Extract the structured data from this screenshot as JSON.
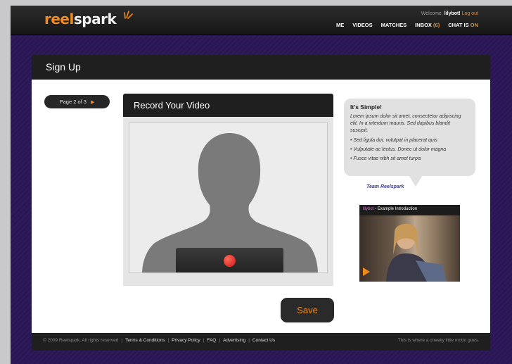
{
  "brand": {
    "logo_text_a": "reel",
    "logo_text_b": "spark"
  },
  "header": {
    "welcome_prefix": "Welcome,",
    "username": "lilybot!",
    "logout": "Log out",
    "nav": [
      {
        "label": "ME"
      },
      {
        "label": "VIDEOS"
      },
      {
        "label": "MATCHES"
      },
      {
        "label": "INBOX",
        "count": "(6)"
      },
      {
        "label": "CHAT IS",
        "status": "ON"
      }
    ]
  },
  "page": {
    "title": "Sign Up",
    "step": "Page 2 of 3"
  },
  "recorder": {
    "title": "Record Your Video",
    "save_label": "Save"
  },
  "tips": {
    "title": "It's Simple!",
    "intro": "Lorem ipsum dolor sit amet, consectetur adipiscing elit. In a interdum mauris. Sed dapibus blandit suscipit.",
    "items": [
      "Sed ligula dui, volutpat in placerat quis",
      "Vulputate ac lectus. Donec ut dolor magna",
      "Fusce vitae nibh sit amet turpis"
    ],
    "signature": "Team Reelspark"
  },
  "example": {
    "user": "lilybot",
    "title": " - Example Introduction"
  },
  "footer": {
    "copyright": "© 2009 Reelspark, All rights reserved",
    "links": [
      "Terms & Conditions",
      "Privacy Policy",
      "FAQ",
      "Advertising",
      "Contact Us"
    ],
    "motto": "This is where a cheeky little motto goes."
  },
  "colors": {
    "accent": "#f28a1d",
    "background": "#2a1655",
    "bar": "#1f1f1f"
  }
}
